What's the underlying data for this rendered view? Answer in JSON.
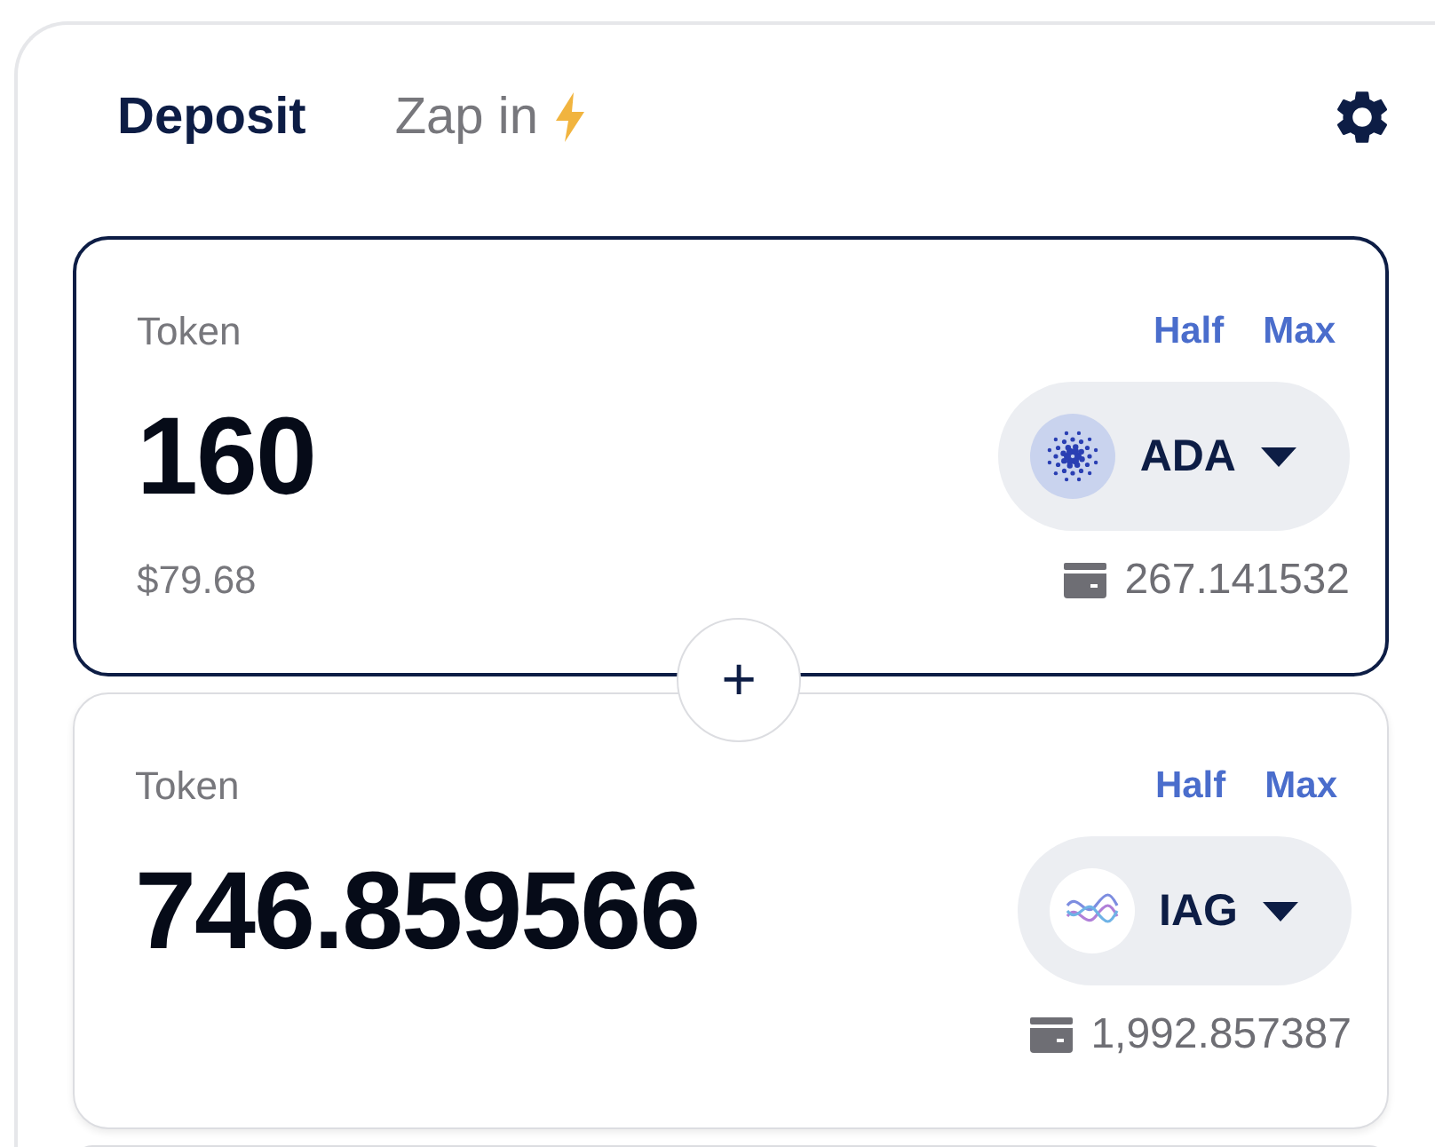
{
  "tabs": [
    {
      "label": "Deposit",
      "selected": true,
      "kind": "plain"
    },
    {
      "label": "Zap in",
      "selected": false,
      "kind": "zap"
    }
  ],
  "cards": [
    {
      "label": "Token",
      "amount": "160",
      "usd": "$79.68",
      "token": "ADA",
      "kind": "ada",
      "balance": "267.141532",
      "focused": true,
      "half": "Half",
      "max": "Max"
    },
    {
      "label": "Token",
      "amount": "746.859566",
      "token": "IAG",
      "kind": "iag",
      "balance": "1,992.857387",
      "focused": false,
      "half": "Half",
      "max": "Max"
    }
  ],
  "add_symbol": "+"
}
